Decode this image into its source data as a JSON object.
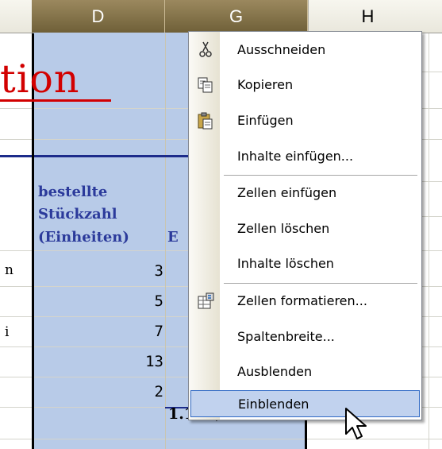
{
  "columns": {
    "d": "D",
    "g": "G",
    "h": "H"
  },
  "sheet": {
    "title_fragment": "tion",
    "header_lines": [
      "bestellte",
      "Stückzahl",
      "(Einheiten)",
      "E"
    ],
    "left_fragments": [
      "n",
      "i"
    ],
    "quantities": [
      "3",
      "5",
      "7",
      "13",
      "2"
    ],
    "total_fragment": "1.120,00 €"
  },
  "context_menu": {
    "items": [
      {
        "label": "Ausschneiden",
        "icon": "scissors-icon"
      },
      {
        "label": "Kopieren",
        "icon": "copy-icon"
      },
      {
        "label": "Einfügen",
        "icon": "paste-icon"
      },
      {
        "label": "Inhalte einfügen..."
      },
      {
        "label": "Zellen einfügen"
      },
      {
        "label": "Zellen löschen"
      },
      {
        "label": "Inhalte löschen"
      },
      {
        "label": "Zellen formatieren...",
        "icon": "format-cells-icon"
      },
      {
        "label": "Spaltenbreite..."
      },
      {
        "label": "Ausblenden"
      },
      {
        "label": "Einblenden",
        "highlighted": true
      }
    ]
  },
  "colors": {
    "selected_column": "#b8cbe8",
    "menu_highlight": "#c1d2ee",
    "title_red": "#d20000",
    "header_blue": "#2b3a9b"
  }
}
